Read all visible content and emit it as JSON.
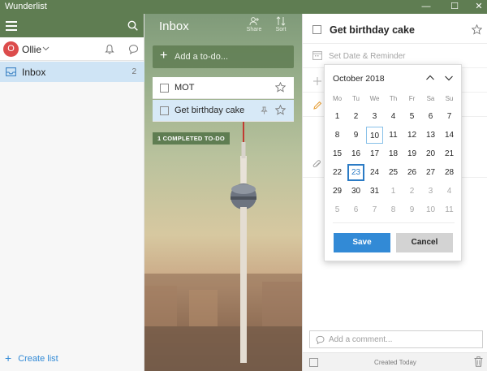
{
  "window": {
    "title": "Wunderlist",
    "min_glyph": "—",
    "max_glyph": "☐",
    "close_glyph": "✕"
  },
  "sidebar": {
    "user": {
      "initial": "O",
      "name": "Ollie"
    },
    "lists": [
      {
        "label": "Inbox",
        "count": "2"
      }
    ],
    "create_list_label": "Create list"
  },
  "middle": {
    "title": "Inbox",
    "share_label": "Share",
    "sort_label": "Sort",
    "add_placeholder": "Add a to-do...",
    "tasks": [
      {
        "title": "MOT"
      },
      {
        "title": "Get birthday cake"
      }
    ],
    "completed_label": "1 COMPLETED TO-DO"
  },
  "detail": {
    "title": "Get birthday cake",
    "date_placeholder": "Set Date & Reminder",
    "comment_placeholder": "Add a comment...",
    "created_label": "Created Today"
  },
  "date_picker": {
    "month": "October 2018",
    "weekdays": [
      "Mo",
      "Tu",
      "We",
      "Th",
      "Fr",
      "Sa",
      "Su"
    ],
    "weeks": [
      [
        "1",
        "2",
        "3",
        "4",
        "5",
        "6",
        "7"
      ],
      [
        "8",
        "9",
        "10",
        "11",
        "12",
        "13",
        "14"
      ],
      [
        "15",
        "16",
        "17",
        "18",
        "19",
        "20",
        "21"
      ],
      [
        "22",
        "23",
        "24",
        "25",
        "26",
        "27",
        "28"
      ],
      [
        "29",
        "30",
        "31",
        "1",
        "2",
        "3",
        "4"
      ],
      [
        "5",
        "6",
        "7",
        "8",
        "9",
        "10",
        "11"
      ]
    ],
    "today": "10",
    "selected": "23",
    "save_label": "Save",
    "cancel_label": "Cancel"
  },
  "colors": {
    "accent_green": "#5f7d52",
    "accent_blue": "#328ad6",
    "avatar_red": "#dc4c4c",
    "selection_blue": "#cfe4f5"
  }
}
